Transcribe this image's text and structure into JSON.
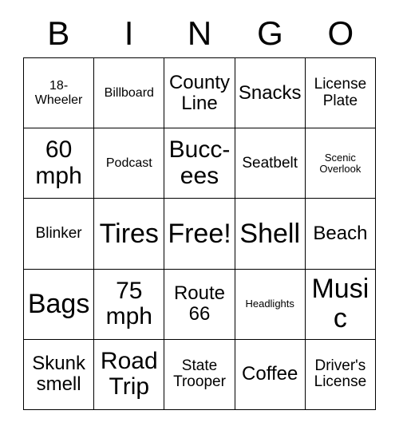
{
  "card": {
    "title": "BINGO",
    "header_letters": [
      "B",
      "I",
      "N",
      "G",
      "O"
    ],
    "free_space_label": "Free!",
    "colors": {
      "background": "#ffffff",
      "text": "#000000",
      "grid_line": "#000000"
    },
    "grid": {
      "rows": 5,
      "columns": 5,
      "cells": [
        [
          {
            "text": "18-\nWheeler",
            "size": "s",
            "is_free": false
          },
          {
            "text": "Billboard",
            "size": "s",
            "is_free": false
          },
          {
            "text": "County\nLine",
            "size": "l",
            "is_free": false
          },
          {
            "text": "Snacks",
            "size": "l",
            "is_free": false
          },
          {
            "text": "License\nPlate",
            "size": "m",
            "is_free": false
          }
        ],
        [
          {
            "text": "60\nmph",
            "size": "xl",
            "is_free": false
          },
          {
            "text": "Podcast",
            "size": "s",
            "is_free": false
          },
          {
            "text": "Bucc-\nees",
            "size": "xl",
            "is_free": false
          },
          {
            "text": "Seatbelt",
            "size": "m",
            "is_free": false
          },
          {
            "text": "Scenic\nOverlook",
            "size": "xs",
            "is_free": false
          }
        ],
        [
          {
            "text": "Blinker",
            "size": "m",
            "is_free": false
          },
          {
            "text": "Tires",
            "size": "xxl",
            "is_free": false
          },
          {
            "text": "Free!",
            "size": "xxl",
            "is_free": true
          },
          {
            "text": "Shell",
            "size": "xxl",
            "is_free": false
          },
          {
            "text": "Beach",
            "size": "l",
            "is_free": false
          }
        ],
        [
          {
            "text": "Bags",
            "size": "xxl",
            "is_free": false
          },
          {
            "text": "75\nmph",
            "size": "xl",
            "is_free": false
          },
          {
            "text": "Route\n66",
            "size": "l",
            "is_free": false
          },
          {
            "text": "Headlights",
            "size": "xs",
            "is_free": false
          },
          {
            "text": "Music",
            "size": "xxl",
            "is_free": false
          }
        ],
        [
          {
            "text": "Skunk\nsmell",
            "size": "l",
            "is_free": false
          },
          {
            "text": "Road\nTrip",
            "size": "xl",
            "is_free": false
          },
          {
            "text": "State\nTrooper",
            "size": "m",
            "is_free": false
          },
          {
            "text": "Coffee",
            "size": "l",
            "is_free": false
          },
          {
            "text": "Driver's\nLicense",
            "size": "m",
            "is_free": false
          }
        ]
      ]
    }
  }
}
